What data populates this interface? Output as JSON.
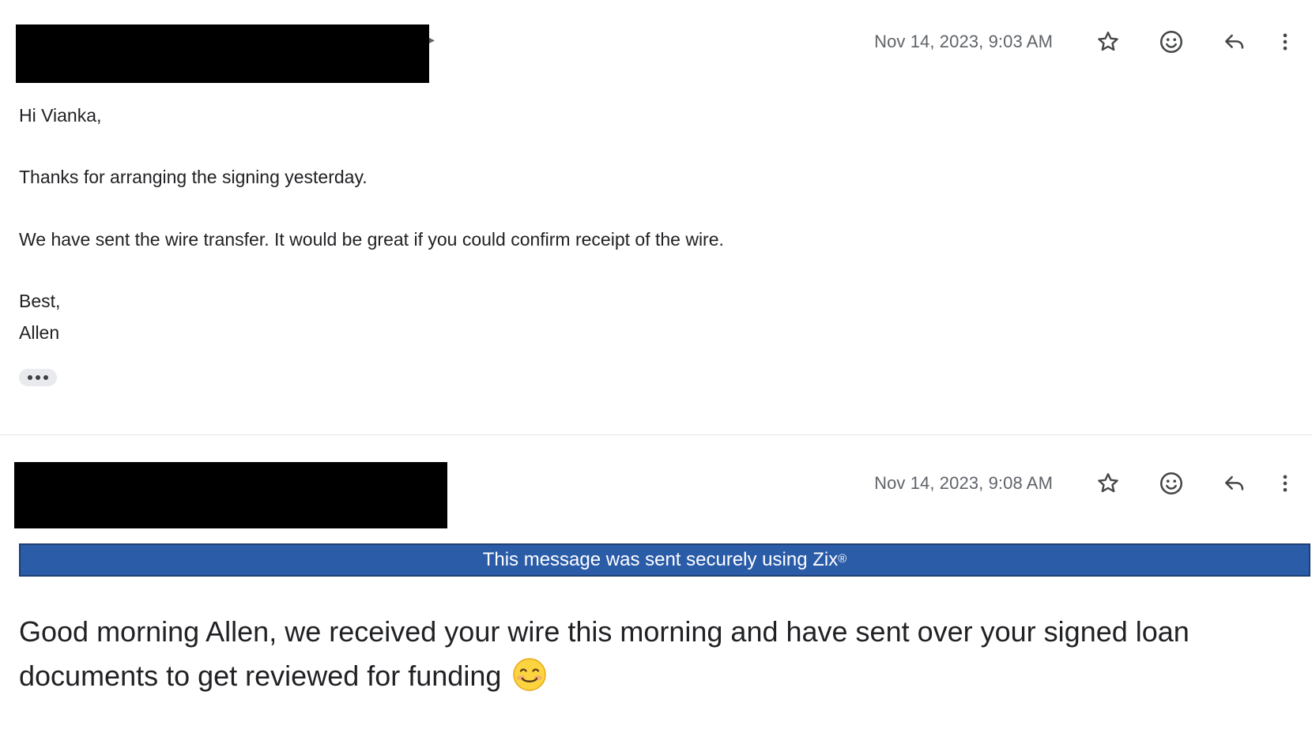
{
  "messages": [
    {
      "timestamp": "Nov 14, 2023, 9:03 AM",
      "body": {
        "greeting": "Hi Vianka,",
        "thanks": "Thanks for arranging the signing yesterday.",
        "wire": "We have sent the wire transfer. It would be great if you could confirm receipt of the wire.",
        "closing": "Best,",
        "signature": "Allen"
      }
    },
    {
      "timestamp": "Nov 14, 2023, 9:08 AM",
      "banner": {
        "text": "This message was sent securely using Zix",
        "mark": "®"
      },
      "body": {
        "text": "Good morning Allen, we received your wire this morning and have sent over your signed loan documents to get reviewed for funding"
      }
    }
  ],
  "icons": {
    "star": "star-icon",
    "emoji": "emoji-reaction-icon",
    "reply": "reply-icon",
    "more": "more-vert-icon",
    "smiley": "smiling-face-emoji"
  },
  "colors": {
    "banner_bg": "#2b5ca8",
    "banner_border": "#1e3f73",
    "text": "#202124",
    "meta_text": "#5f6368",
    "redaction": "#000000"
  }
}
